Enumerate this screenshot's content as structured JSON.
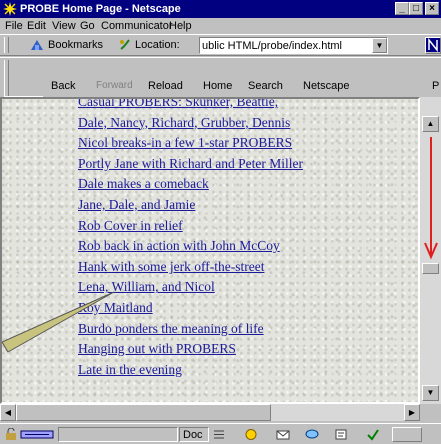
{
  "window": {
    "title": "PROBE Home Page - Netscape",
    "minimize": "_",
    "maximize": "□",
    "close": "×"
  },
  "menu": [
    "File",
    "Edit",
    "View",
    "Go",
    "Communicator",
    "Help"
  ],
  "location_bar": {
    "bookmarks_label": "Bookmarks",
    "location_label": "Location:",
    "url": "ublic HTML/probe/index.html"
  },
  "toolbar": [
    "Back",
    "Forward",
    "Reload",
    "Home",
    "Search",
    "Netscape",
    "P"
  ],
  "links": [
    "Casual PROBERS: Skunker, Beattie,",
    "Dale, Nancy, Richard, Grubber, Dennis",
    "Nicol breaks-in a few 1-star PROBERS",
    "Portly Jane with Richard and Peter Miller",
    "Dale makes a comeback",
    "Jane, Dale, and Jamie",
    "Rob Cover in relief",
    "Rob back in action with John McCoy",
    "Hank with some jerk off-the-street",
    "Lena, William, and Nicol",
    "Roy Maitland",
    "Burdo ponders the meaning of life",
    "Hanging out with PROBERS",
    "Late in the evening"
  ],
  "status": {
    "doc_label": "Doc"
  },
  "colors": {
    "title_bg": "#000080",
    "link": "#1a1a9a",
    "arrow": "#e02020"
  }
}
